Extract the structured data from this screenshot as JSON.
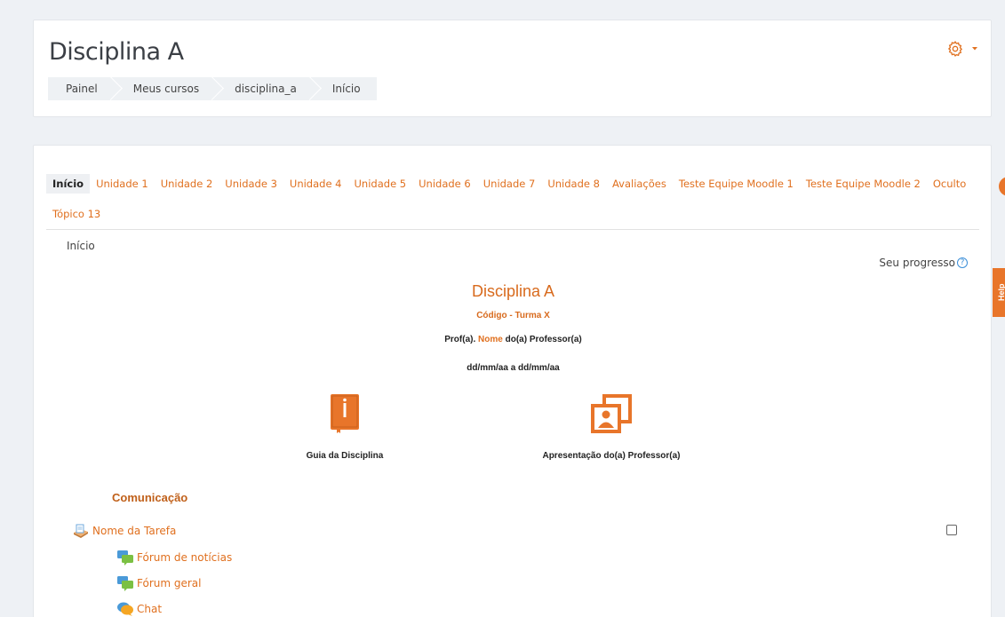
{
  "header": {
    "title": "Disciplina A",
    "breadcrumb": [
      "Painel",
      "Meus cursos",
      "disciplina_a",
      "Início"
    ],
    "settings_icon": "gear-icon"
  },
  "tabs": [
    {
      "label": "Início",
      "active": true
    },
    {
      "label": "Unidade 1"
    },
    {
      "label": "Unidade 2"
    },
    {
      "label": "Unidade 3"
    },
    {
      "label": "Unidade 4"
    },
    {
      "label": "Unidade 5"
    },
    {
      "label": "Unidade 6"
    },
    {
      "label": "Unidade 7"
    },
    {
      "label": "Unidade 8"
    },
    {
      "label": "Avaliações"
    },
    {
      "label": "Teste Equipe Moodle 1"
    },
    {
      "label": "Teste Equipe Moodle 2"
    },
    {
      "label": "Oculto"
    },
    {
      "label": "Tópico 13"
    }
  ],
  "section": {
    "label": "Início",
    "progress_label": "Seu progresso",
    "course_name": "Disciplina A",
    "course_code": "Código - Turma X",
    "professor_prefix": "Prof(a). ",
    "professor_name": "Nome",
    "professor_suffix": " do(a) Professor(a)",
    "date_range": "dd/mm/aa a dd/mm/aa"
  },
  "resources": [
    {
      "label": "Guia da Disciplina",
      "icon": "info-book-icon"
    },
    {
      "label": "Apresentação do(a) Professor(a)",
      "icon": "profile-photos-icon"
    }
  ],
  "communication": {
    "heading": "Comunicação",
    "activities": [
      {
        "label": "Nome da Tarefa",
        "icon": "assignment-icon",
        "has_completion": true
      },
      {
        "label": "Fórum de notícias",
        "icon": "forum-icon"
      },
      {
        "label": "Fórum geral",
        "icon": "forum-icon"
      },
      {
        "label": "Chat",
        "icon": "chat-icon"
      }
    ]
  },
  "side_tab": {
    "label": "Help"
  },
  "colors": {
    "accent": "#e0701f",
    "icon_orange": "#e8752a",
    "background": "#eef1f5"
  }
}
